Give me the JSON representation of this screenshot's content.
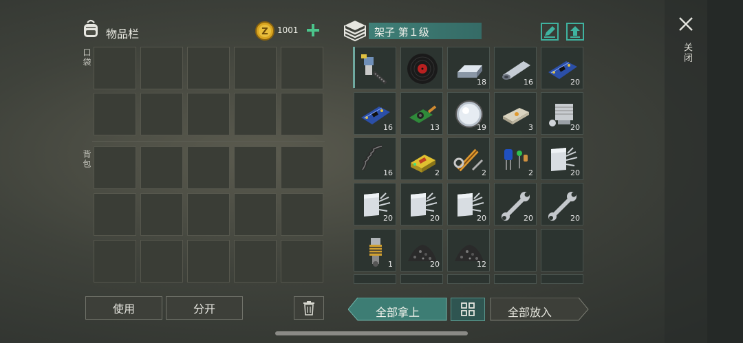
{
  "inventory": {
    "title": "物品栏",
    "currency_amount": "1001",
    "pocket_label": "口袋",
    "backpack_label": "背包"
  },
  "container": {
    "title": "架子 第１级",
    "items": [
      {
        "icon": "drill-icon",
        "count": ""
      },
      {
        "icon": "vinyl-record-icon",
        "count": ""
      },
      {
        "icon": "metal-ingot-icon",
        "count": "18"
      },
      {
        "icon": "sheet-metal-roll-icon",
        "count": "16"
      },
      {
        "icon": "circuit-board-icon",
        "count": "20"
      },
      {
        "icon": "circuit-board-icon",
        "count": "16"
      },
      {
        "icon": "camera-module-icon",
        "count": "13"
      },
      {
        "icon": "lens-icon",
        "count": "19"
      },
      {
        "icon": "eraser-icon",
        "count": "3"
      },
      {
        "icon": "engine-cylinder-icon",
        "count": "20"
      },
      {
        "icon": "spring-icon",
        "count": "16"
      },
      {
        "icon": "battery-icon",
        "count": "2"
      },
      {
        "icon": "hydraulic-parts-icon",
        "count": "2"
      },
      {
        "icon": "electronic-components-icon",
        "count": "2"
      },
      {
        "icon": "scrap-metal-icon",
        "count": "20"
      },
      {
        "icon": "scrap-metal-icon",
        "count": "20"
      },
      {
        "icon": "scrap-metal-icon",
        "count": "20"
      },
      {
        "icon": "scrap-metal-icon",
        "count": "20"
      },
      {
        "icon": "wrench-icon",
        "count": "20"
      },
      {
        "icon": "wrench-icon",
        "count": "20"
      },
      {
        "icon": "shock-absorber-icon",
        "count": "1"
      },
      {
        "icon": "gravel-pile-icon",
        "count": "20"
      },
      {
        "icon": "gravel-pile-icon",
        "count": "12"
      },
      {
        "icon": "",
        "count": ""
      },
      {
        "icon": "",
        "count": ""
      }
    ]
  },
  "buttons": {
    "use": "使用",
    "split": "分开",
    "take_all": "全部拿上",
    "put_all": "全部放入"
  },
  "close_label": "关闭",
  "colors": {
    "teal_accent": "#3f7f77",
    "plus_green": "#4bc48b",
    "slot_bg": "#2c3430"
  }
}
